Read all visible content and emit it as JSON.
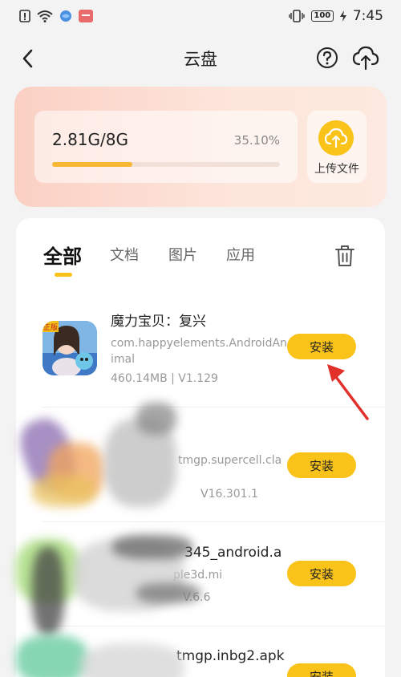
{
  "status_bar": {
    "time": "7:45",
    "battery": "100",
    "icons": [
      "alert-icon",
      "wifi-icon",
      "browser-icon",
      "app-notification-icon",
      "vibrate-icon",
      "battery-icon",
      "charging-icon"
    ]
  },
  "header": {
    "title": "云盘",
    "icons": [
      "back-icon",
      "help-icon",
      "cloud-upload-icon"
    ]
  },
  "storage": {
    "usage": "2.81G/8G",
    "percent_label": "35.10%",
    "percent": 35.1,
    "upload_label": "上传文件",
    "accent_color": "#f9c31a"
  },
  "tabs": [
    {
      "label": "全部",
      "active": true
    },
    {
      "label": "文档",
      "active": false
    },
    {
      "label": "图片",
      "active": false
    },
    {
      "label": "应用",
      "active": false
    }
  ],
  "apps": [
    {
      "name": "魔力宝贝：复兴",
      "package": "com.happyelements.AndroidAnimal",
      "size": "460.14MB | V1.129",
      "button": "安装"
    },
    {
      "name": "",
      "package": "tmgp.supercell.cla",
      "size": "V16.301.1",
      "button": "安装"
    },
    {
      "name": "345_android.a",
      "package": "ple3d.mi",
      "size": "V.6.6",
      "button": "安装"
    },
    {
      "name": "tmgp.inbg2.apk",
      "package": "",
      "size": "",
      "button": "安装"
    }
  ],
  "badge": {
    "label": "正版"
  }
}
